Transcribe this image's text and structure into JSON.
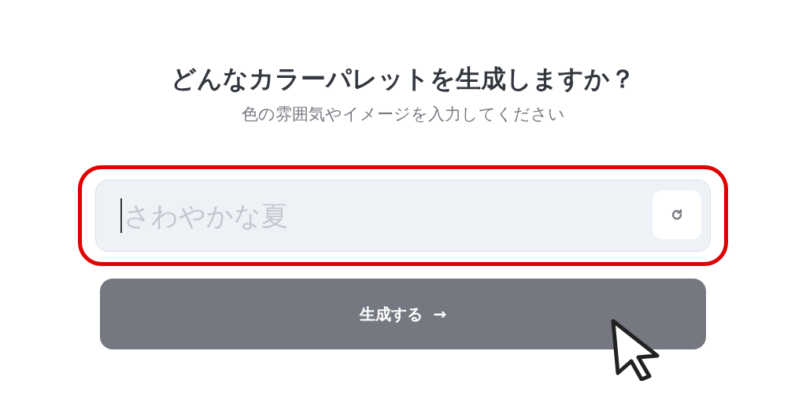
{
  "heading": {
    "title": "どんなカラーパレットを生成しますか？",
    "subtitle": "色の雰囲気やイメージを入力してください"
  },
  "prompt": {
    "placeholder": "さわやかな夏",
    "focused": true,
    "highlighted": true
  },
  "generate_button": {
    "label": "生成する",
    "arrow": "→"
  },
  "pointer": {
    "visible": true
  }
}
